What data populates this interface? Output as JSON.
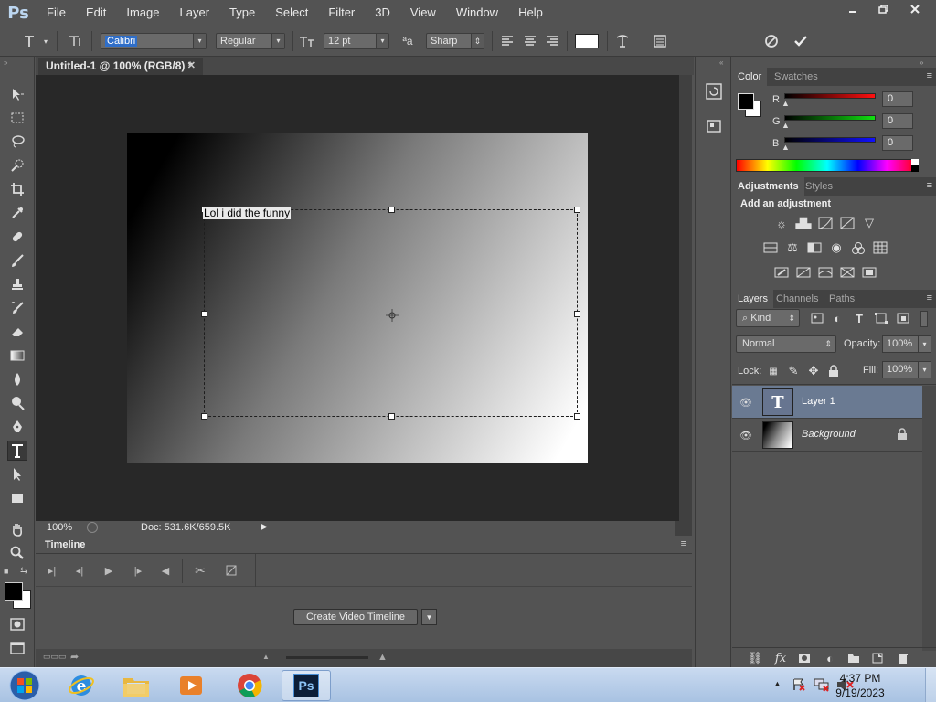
{
  "app": {
    "logo": "Ps"
  },
  "menu": [
    "File",
    "Edit",
    "Image",
    "Layer",
    "Type",
    "Select",
    "Filter",
    "3D",
    "View",
    "Window",
    "Help"
  ],
  "options_bar": {
    "font_family": "Calibri",
    "font_style": "Regular",
    "font_size": "12 pt",
    "antialias": "Sharp"
  },
  "document": {
    "tab_title": "Untitled-1 @ 100% (RGB/8) *",
    "canvas_text": "Lol i did the funny",
    "zoom": "100%",
    "doc_info": "Doc: 531.6K/659.5K"
  },
  "timeline": {
    "title": "Timeline",
    "create_button": "Create Video Timeline"
  },
  "color_panel": {
    "tabs": [
      "Color",
      "Swatches"
    ],
    "channels": [
      {
        "label": "R",
        "value": "0",
        "color": "#e02020"
      },
      {
        "label": "G",
        "value": "0",
        "color": "#20c020"
      },
      {
        "label": "B",
        "value": "0",
        "color": "#2020e0"
      }
    ]
  },
  "adjustments_panel": {
    "tabs": [
      "Adjustments",
      "Styles"
    ],
    "heading": "Add an adjustment"
  },
  "layers_panel": {
    "tabs": [
      "Layers",
      "Channels",
      "Paths"
    ],
    "filter_kind": "Kind",
    "blend_mode": "Normal",
    "opacity_label": "Opacity:",
    "opacity": "100%",
    "lock_label": "Lock:",
    "fill_label": "Fill:",
    "fill": "100%",
    "layers": [
      {
        "name": "Layer 1",
        "type": "text",
        "selected": true
      },
      {
        "name": "Background",
        "type": "image",
        "locked": true
      }
    ]
  },
  "taskbar": {
    "time": "4:37 PM",
    "date": "9/19/2023",
    "ps_label": "Ps"
  },
  "colors": {
    "ui_bg": "#535353",
    "doc_bg": "#282828",
    "selected_layer": "#6a7a92",
    "taskbar": "#b9cfea"
  }
}
